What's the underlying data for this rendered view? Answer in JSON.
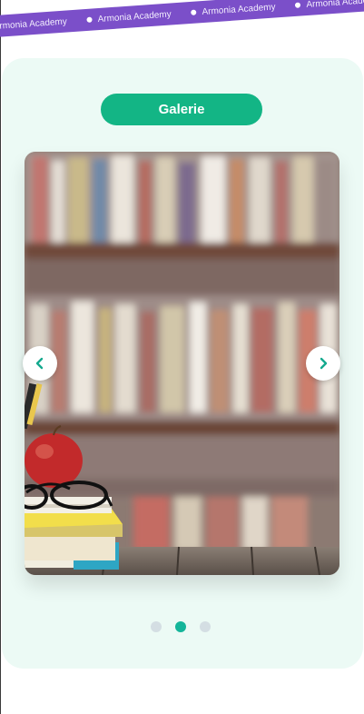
{
  "marquee": {
    "items": [
      "Armonia Academy",
      "Armonia Academy",
      "Armonia Academy",
      "Armonia Academy"
    ]
  },
  "gallery": {
    "title": "Galerie",
    "image_icon": "library-books-apple-glasses-photo",
    "prev_icon": "chevron-left-icon",
    "next_icon": "chevron-right-icon",
    "slide_count": 3,
    "active_slide": 2
  },
  "colors": {
    "accent": "#13b585",
    "banner": "#7b4fc9",
    "panel": "#ecfaf5",
    "dot_active": "#14b59a",
    "dot_inactive": "#d4dee3"
  }
}
